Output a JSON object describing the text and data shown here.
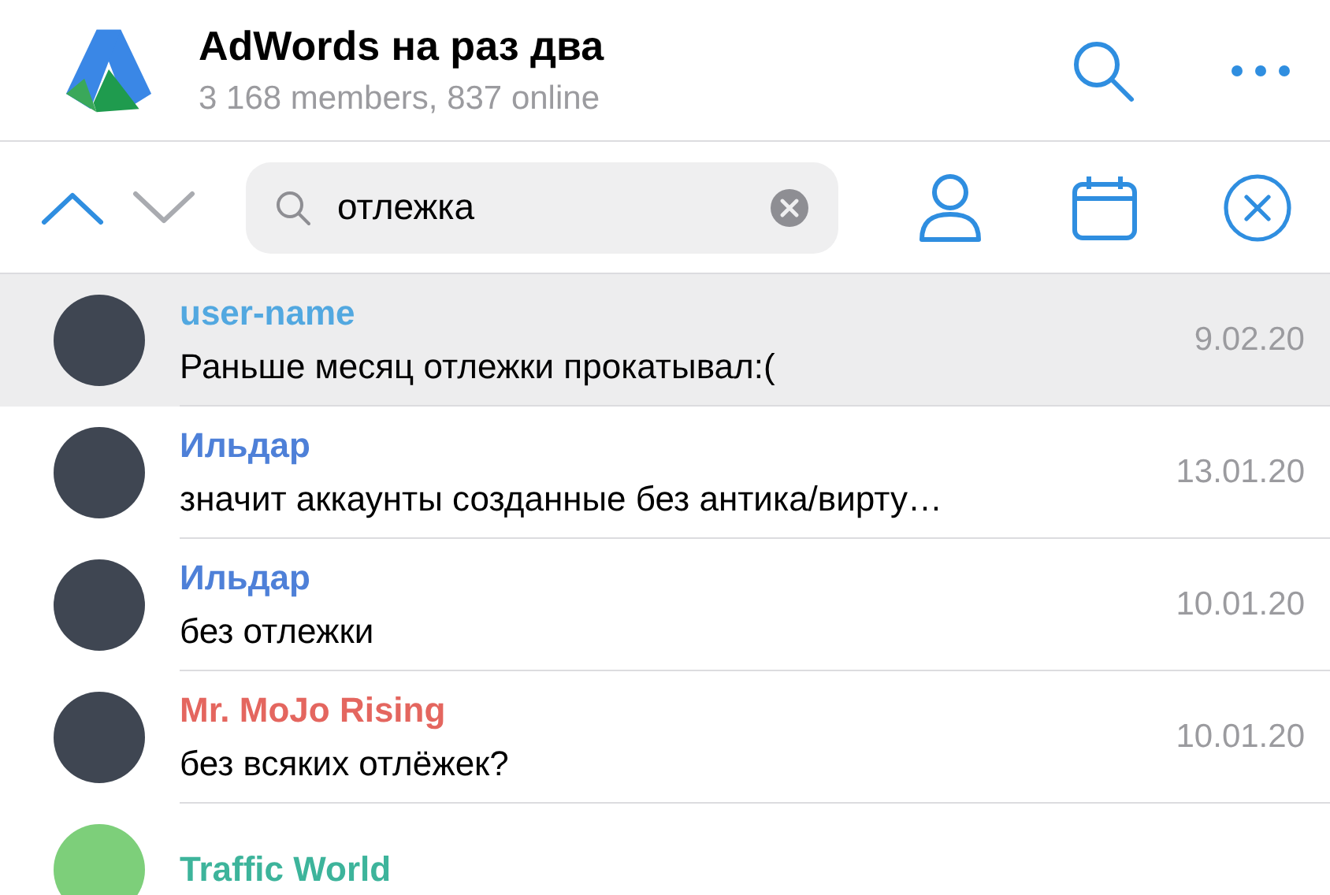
{
  "chat": {
    "title": "AdWords на раз два",
    "subtitle": "3 168 members, 837 online"
  },
  "navigation": {
    "previous_enabled": true,
    "next_enabled": false
  },
  "search": {
    "value": "отлежка"
  },
  "results": [
    {
      "name": "user-name",
      "color": "#52a8e0",
      "text": "Раньше месяц отлежки прокатывал:(",
      "date": "9.02.20",
      "selected": true
    },
    {
      "name": "Ильдар",
      "color": "#4e80d8",
      "text": "значит аккаунты созданные без антика/вирту…",
      "date": "13.01.20",
      "selected": false
    },
    {
      "name": "Ильдар",
      "color": "#4e80d8",
      "text": "без отлежки",
      "date": "10.01.20",
      "selected": false
    },
    {
      "name": "Mr. MoJo Rising",
      "color": "#e4665f",
      "text": "без всяких отлёжек?",
      "date": "10.01.20",
      "selected": false
    },
    {
      "name": "Traffic World",
      "color": "#3db49b",
      "selected": false
    }
  ]
}
